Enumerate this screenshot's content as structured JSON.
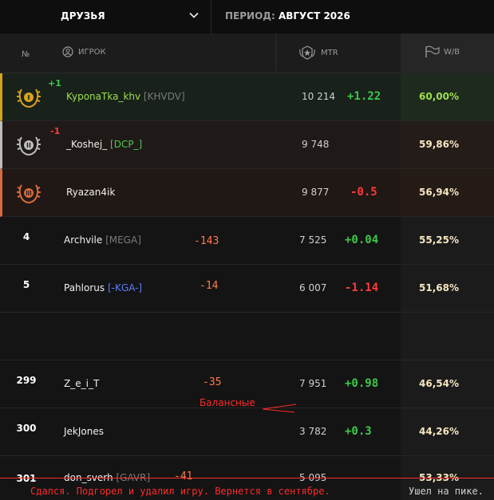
{
  "topbar": {
    "dropdown_label": "ДРУЗЬЯ",
    "period_prefix": "ПЕРИОД:",
    "period_value": "АВГУСТ 2026"
  },
  "header": {
    "num": "№",
    "player": "ИГРОК",
    "mtr": "MTR",
    "wb": "W/B"
  },
  "rows": [
    {
      "rank": "",
      "medal": "gold",
      "rank_delta": "+1",
      "name": "KyponaTka_khv",
      "clan": "[KHVDV]",
      "mtr": "10 214",
      "mtr_delta": "+1.22",
      "wb": "60,00%"
    },
    {
      "rank": "",
      "medal": "silver",
      "rank_delta": "-1",
      "name": "_Koshej_",
      "clan": "[DCP_]",
      "mtr": "9 748",
      "mtr_delta": "",
      "wb": "59,86%"
    },
    {
      "rank": "",
      "medal": "bronze",
      "rank_delta": "",
      "name": "Ryazan4ik",
      "clan": "",
      "mtr": "9 877",
      "mtr_delta": "-0.5",
      "wb": "56,94%"
    },
    {
      "rank": "4",
      "name": "Archvile",
      "clan": "[MEGA]",
      "annotation": "-143",
      "mtr": "7 525",
      "mtr_delta": "+0.04",
      "wb": "55,25%"
    },
    {
      "rank": "5",
      "name": "Pahlorus",
      "clan": "[-KGA-]",
      "annotation": "-14",
      "mtr": "6 007",
      "mtr_delta": "-1.14",
      "wb": "51,68%"
    },
    {
      "rank": "299",
      "name": "Z_e_i_T",
      "clan": "",
      "annotation": "-35",
      "mtr": "7 951",
      "mtr_delta": "+0.98",
      "wb": "46,54%"
    },
    {
      "rank": "300",
      "name": "JekJones",
      "clan": "",
      "mtr": "3 782",
      "mtr_delta": "+0.3",
      "wb": "44,26%"
    },
    {
      "rank": "301",
      "name": "don_sverh",
      "clan": "[GAVR]",
      "annotation": "-41",
      "mtr": "5 095",
      "mtr_delta": "",
      "wb": "53,33%"
    }
  ],
  "annotations": {
    "balance": "Балансные",
    "note_left": "Сдался. Подгорел и удалил игру. Вернется в сентябре.",
    "note_right": "Ушел на пике."
  },
  "colors": {
    "gold": "#d8a21e",
    "silver": "#bdbdbd",
    "bronze": "#d86a3a",
    "positive": "#3fc74c",
    "negative": "#ff3a3a"
  }
}
